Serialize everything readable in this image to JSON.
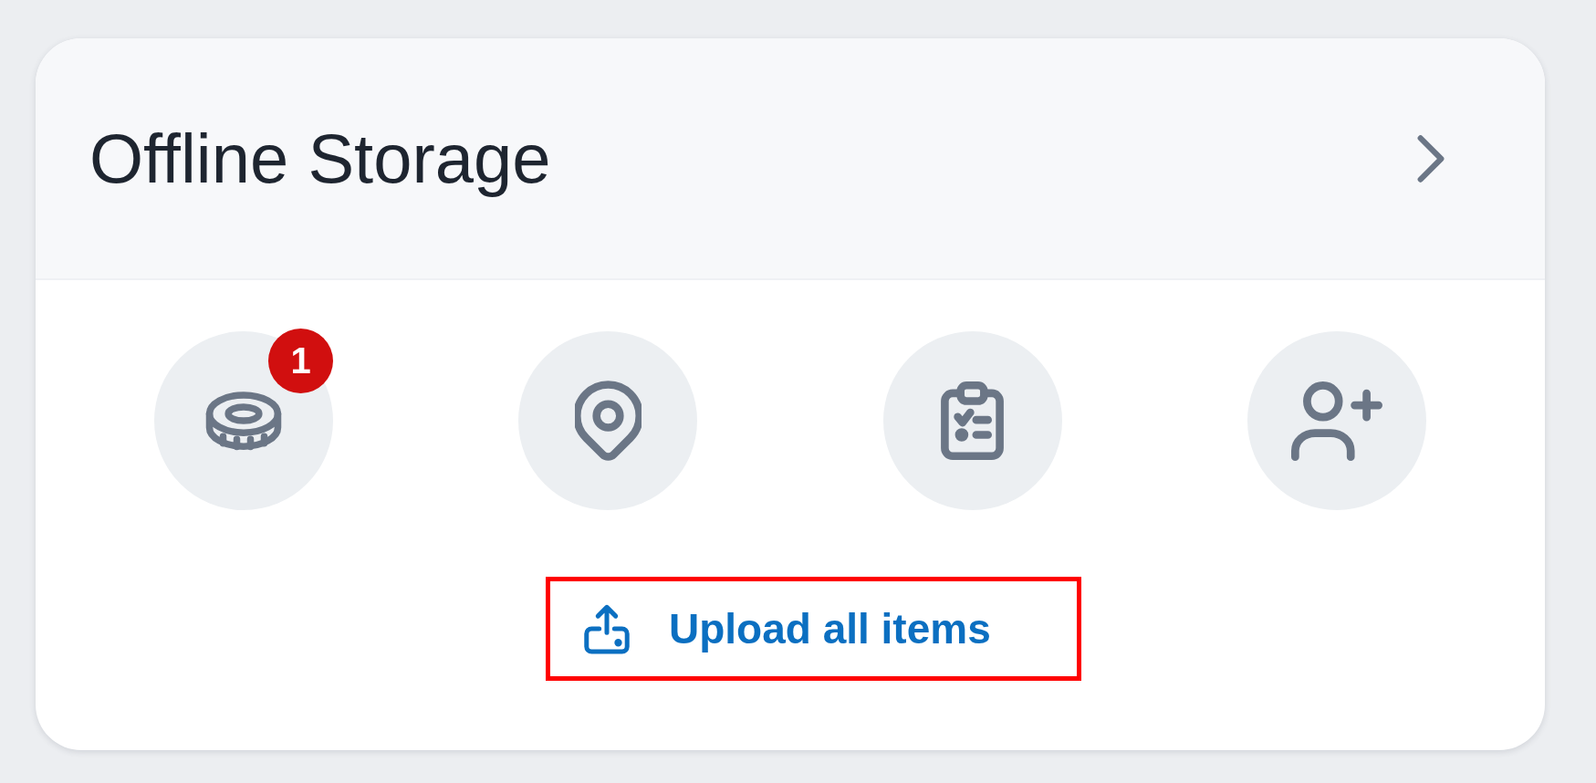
{
  "card": {
    "title": "Offline Storage"
  },
  "shortcuts": [
    {
      "kind": "coin",
      "badge": "1"
    },
    {
      "kind": "pin"
    },
    {
      "kind": "clipboard"
    },
    {
      "kind": "user-add"
    }
  ],
  "upload_button": {
    "label": "Upload all items",
    "highlighted": true
  }
}
